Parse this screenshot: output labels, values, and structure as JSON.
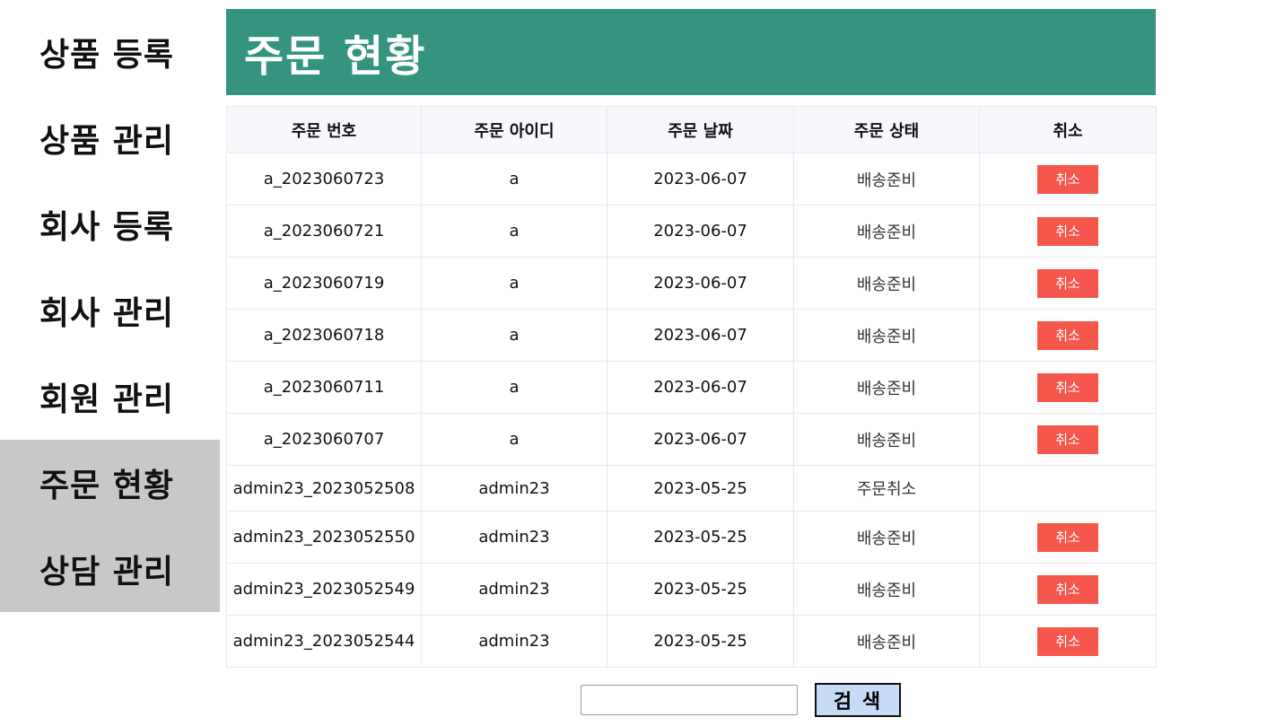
{
  "sidebar": {
    "items": [
      {
        "label": "상품 등록"
      },
      {
        "label": "상품 관리"
      },
      {
        "label": "회사 등록"
      },
      {
        "label": "회사 관리"
      },
      {
        "label": "회원 관리"
      },
      {
        "label": "주문 현황"
      },
      {
        "label": "상담 관리"
      }
    ]
  },
  "header": {
    "title": "주문 현황"
  },
  "table": {
    "columns": [
      "주문 번호",
      "주문 아이디",
      "주문 날짜",
      "주문 상태",
      "취소"
    ],
    "rows": [
      {
        "order_no": "a_2023060723",
        "order_id": "a",
        "date": "2023-06-07",
        "status": "배송준비",
        "cancel": "취소"
      },
      {
        "order_no": "a_2023060721",
        "order_id": "a",
        "date": "2023-06-07",
        "status": "배송준비",
        "cancel": "취소"
      },
      {
        "order_no": "a_2023060719",
        "order_id": "a",
        "date": "2023-06-07",
        "status": "배송준비",
        "cancel": "취소"
      },
      {
        "order_no": "a_2023060718",
        "order_id": "a",
        "date": "2023-06-07",
        "status": "배송준비",
        "cancel": "취소"
      },
      {
        "order_no": "a_2023060711",
        "order_id": "a",
        "date": "2023-06-07",
        "status": "배송준비",
        "cancel": "취소"
      },
      {
        "order_no": "a_2023060707",
        "order_id": "a",
        "date": "2023-06-07",
        "status": "배송준비",
        "cancel": "취소"
      },
      {
        "order_no": "admin23_2023052508",
        "order_id": "admin23",
        "date": "2023-05-25",
        "status": "주문취소",
        "cancel": ""
      },
      {
        "order_no": "admin23_2023052550",
        "order_id": "admin23",
        "date": "2023-05-25",
        "status": "배송준비",
        "cancel": "취소"
      },
      {
        "order_no": "admin23_2023052549",
        "order_id": "admin23",
        "date": "2023-05-25",
        "status": "배송준비",
        "cancel": "취소"
      },
      {
        "order_no": "admin23_2023052544",
        "order_id": "admin23",
        "date": "2023-05-25",
        "status": "배송준비",
        "cancel": "취소"
      }
    ]
  },
  "search": {
    "value": "",
    "button_label": "검 색"
  },
  "colors": {
    "header_bg": "#359480",
    "cancel_btn": "#f5574c",
    "sidebar_highlight": "#c8c8c8",
    "search_btn": "#c5dbf7"
  }
}
